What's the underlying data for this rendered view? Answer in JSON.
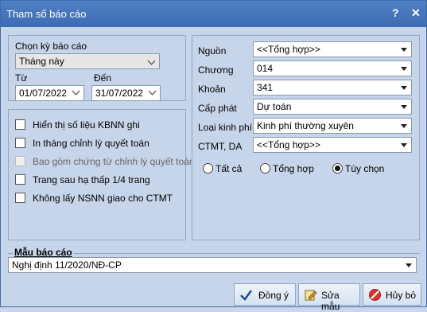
{
  "window": {
    "title": "Tham số báo cáo",
    "help": "?",
    "close": "✕"
  },
  "period": {
    "label": "Chọn kỳ báo cáo",
    "value": "Tháng này",
    "from_label": "Từ",
    "from_value": "01/07/2022",
    "to_label": "Đến",
    "to_value": "31/07/2022"
  },
  "options": [
    {
      "label": "Hiển thị số liệu KBNN ghi",
      "checked": false,
      "enabled": true
    },
    {
      "label": "In tháng chỉnh lý quyết toán",
      "checked": false,
      "enabled": true
    },
    {
      "label": "Bao gồm chứng từ chỉnh lý quyết toán",
      "checked": false,
      "enabled": false
    },
    {
      "label": "Trang sau hạ thấp 1/4 trang",
      "checked": false,
      "enabled": true
    },
    {
      "label": "Không lấy NSNN giao cho CTMT",
      "checked": false,
      "enabled": true
    }
  ],
  "filters": {
    "nguon": {
      "label": "Nguồn",
      "value": "<<Tổng hợp>>"
    },
    "chuong": {
      "label": "Chương",
      "value": "014"
    },
    "khoan": {
      "label": "Khoản",
      "value": "341"
    },
    "cap_phat": {
      "label": "Cấp phát",
      "value": "Dự toán"
    },
    "loai_kinh_phi": {
      "label": "Loại kinh phí",
      "value": "Kinh phí thường xuyên"
    },
    "ctmt": {
      "label": "CTMT, DA",
      "value": "<<Tổng hợp>>"
    }
  },
  "radios": [
    {
      "label": "Tất cả",
      "selected": false
    },
    {
      "label": "Tổng hợp",
      "selected": false
    },
    {
      "label": "Tùy chọn",
      "selected": true
    }
  ],
  "template": {
    "label": "Mẫu báo cáo",
    "value": "Nghị định 11/2020/NĐ-CP"
  },
  "buttons": {
    "ok": "Đồng ý",
    "edit": "Sửa mẫu",
    "cancel": "Hủy bỏ"
  },
  "colors": {
    "titlebar": "#4574ba",
    "background": "#c7d5ea"
  }
}
